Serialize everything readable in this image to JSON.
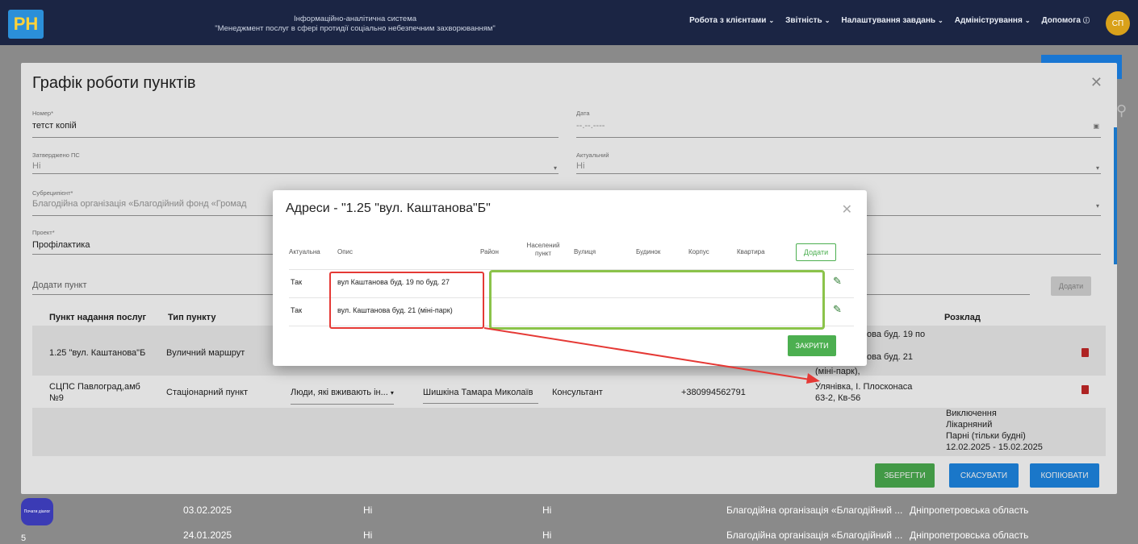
{
  "header": {
    "logo_text": "PH",
    "system_title_line1": "Інформаційно-аналітична система",
    "system_title_line2": "\"Менеджмент послуг в сфері протидії соціально небезпечним захворюванням\"",
    "nav": [
      "Робота з клієнтами",
      "Звітність",
      "Налаштування завдань",
      "Адміністрування",
      "Допомога"
    ],
    "avatar": "СП"
  },
  "background_rows": [
    {
      "date": "03.02.2025",
      "a": "Ні",
      "b": "Ні",
      "org": "Благодійна організація «Благодійний ...",
      "region": "Дніпропетровська область"
    },
    {
      "date": "24.01.2025",
      "a": "Ні",
      "b": "Ні",
      "org": "Благодійна організація «Благодійний ...",
      "region": "Дніпропетровська область"
    }
  ],
  "page_number": "5",
  "chat_button": "Почати діалог",
  "modal": {
    "title": "Графік роботи пунктів",
    "fields": {
      "number_label": "Номер*",
      "number_value": "тетст копій",
      "date_label": "Дата",
      "date_value": "--.--.----",
      "approved_label": "Затверджено ПС",
      "approved_value": "Ні",
      "actual_label": "Актуальний",
      "actual_value": "Ні",
      "subrecipient_label": "Субреципієнт*",
      "subrecipient_value": "Благодійна організація «Благодійний фонд «Громад",
      "project_label": "Проект*",
      "project_value": "Профілактика"
    },
    "add_point_placeholder": "Додати пункт",
    "add_point_button": "Додати",
    "table_headers": [
      "Пункт надання послуг",
      "Тип пункту",
      "Розклад"
    ],
    "rows": [
      {
        "point": "1.25 \"вул. Каштанова\"Б",
        "type": "Вуличний маршрут",
        "schedule_1": "ова буд. 19 по",
        "schedule_2": "ова буд. 21",
        "schedule_3": "(міні-парк),"
      },
      {
        "point_1": "СЦПС Павлоград,амб",
        "point_2": "№9",
        "type": "Стаціонарний пункт",
        "group": "Люди, які вживають ін...",
        "person": "Шишкіна Тамара Миколаїв",
        "role": "Консультант",
        "phone": "+380994562791",
        "schedule_1": "Улянівка, І. Плосконаса",
        "schedule_2": "63-2, Кв-56"
      },
      {
        "schedule_1": "Виключення",
        "schedule_2": "Лікарняний",
        "schedule_3": "Парні (тільки будні)",
        "schedule_4": "12.02.2025 - 15.02.2025"
      }
    ],
    "buttons": {
      "save": "ЗБЕРЕГТИ",
      "cancel": "СКАСУВАТИ",
      "copy": "КОПІЮВАТИ"
    }
  },
  "dialog": {
    "title": "Адреси - \"1.25 \"вул. Каштанова\"Б\"",
    "headers": [
      "Актуальна",
      "Опис",
      "Район",
      "Населений пункт",
      "Вулиця",
      "Будинок",
      "Корпус",
      "Квартира"
    ],
    "add_button": "Додати",
    "rows": [
      {
        "actual": "Так",
        "description": "вул Каштанова буд. 19 по буд. 27"
      },
      {
        "actual": "Так",
        "description": "вул. Каштанова буд. 21 (міні-парк)"
      }
    ],
    "close_button": "ЗАКРИТИ"
  },
  "colors": {
    "annotation_red": "#e53935",
    "annotation_green": "#8bc34a",
    "primary": "#1e88e5",
    "success": "#4caf50",
    "header_bg": "#1b2544"
  }
}
